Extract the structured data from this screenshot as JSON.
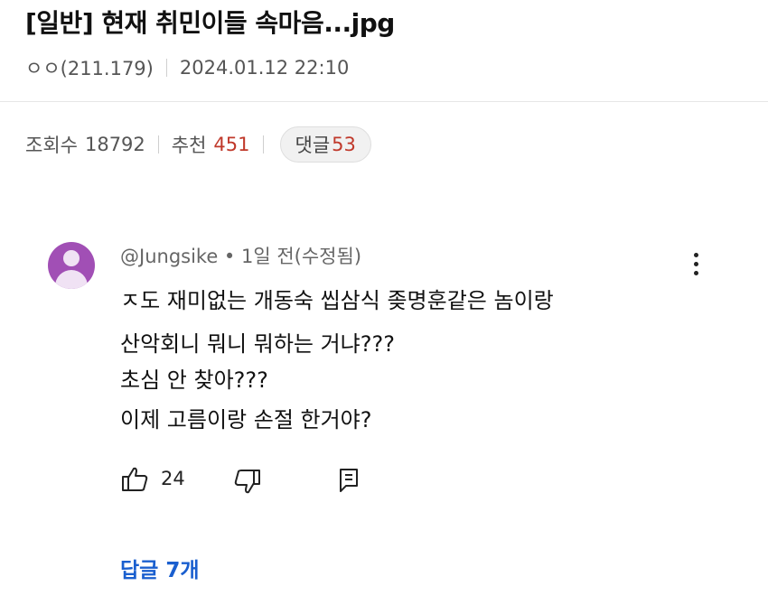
{
  "post": {
    "title": "[일반] 현재 취민이들 속마음...jpg",
    "author": "ㅇㅇ(211.179)",
    "datetime": "2024.01.12 22:10",
    "views_label": "조회수",
    "views": "18792",
    "recommend_label": "추천",
    "recommend": "451",
    "comments_label": "댓글",
    "comments": "53"
  },
  "comment": {
    "header": "@Jungsike • 1일 전(수정됨)",
    "lines": [
      "ㅈ도 재미없는 개동숙 씹삼식 좆명훈같은 놈이랑",
      "산악회니 뭐니 뭐하는 거냐???",
      " 초심 안 찾아???",
      "이제 고름이랑 손절 한거야?"
    ],
    "likes": "24",
    "replies_link": "답글 7개"
  },
  "icons": {
    "avatar": "default-avatar-icon",
    "more": "kebab-menu-icon",
    "like": "thumbs-up-icon",
    "dislike": "thumbs-down-icon",
    "reply": "reply-comment-icon"
  },
  "colors": {
    "avatar": "#a14fb5",
    "accent_red": "#c0392b",
    "link_blue": "#1a5fcf"
  }
}
